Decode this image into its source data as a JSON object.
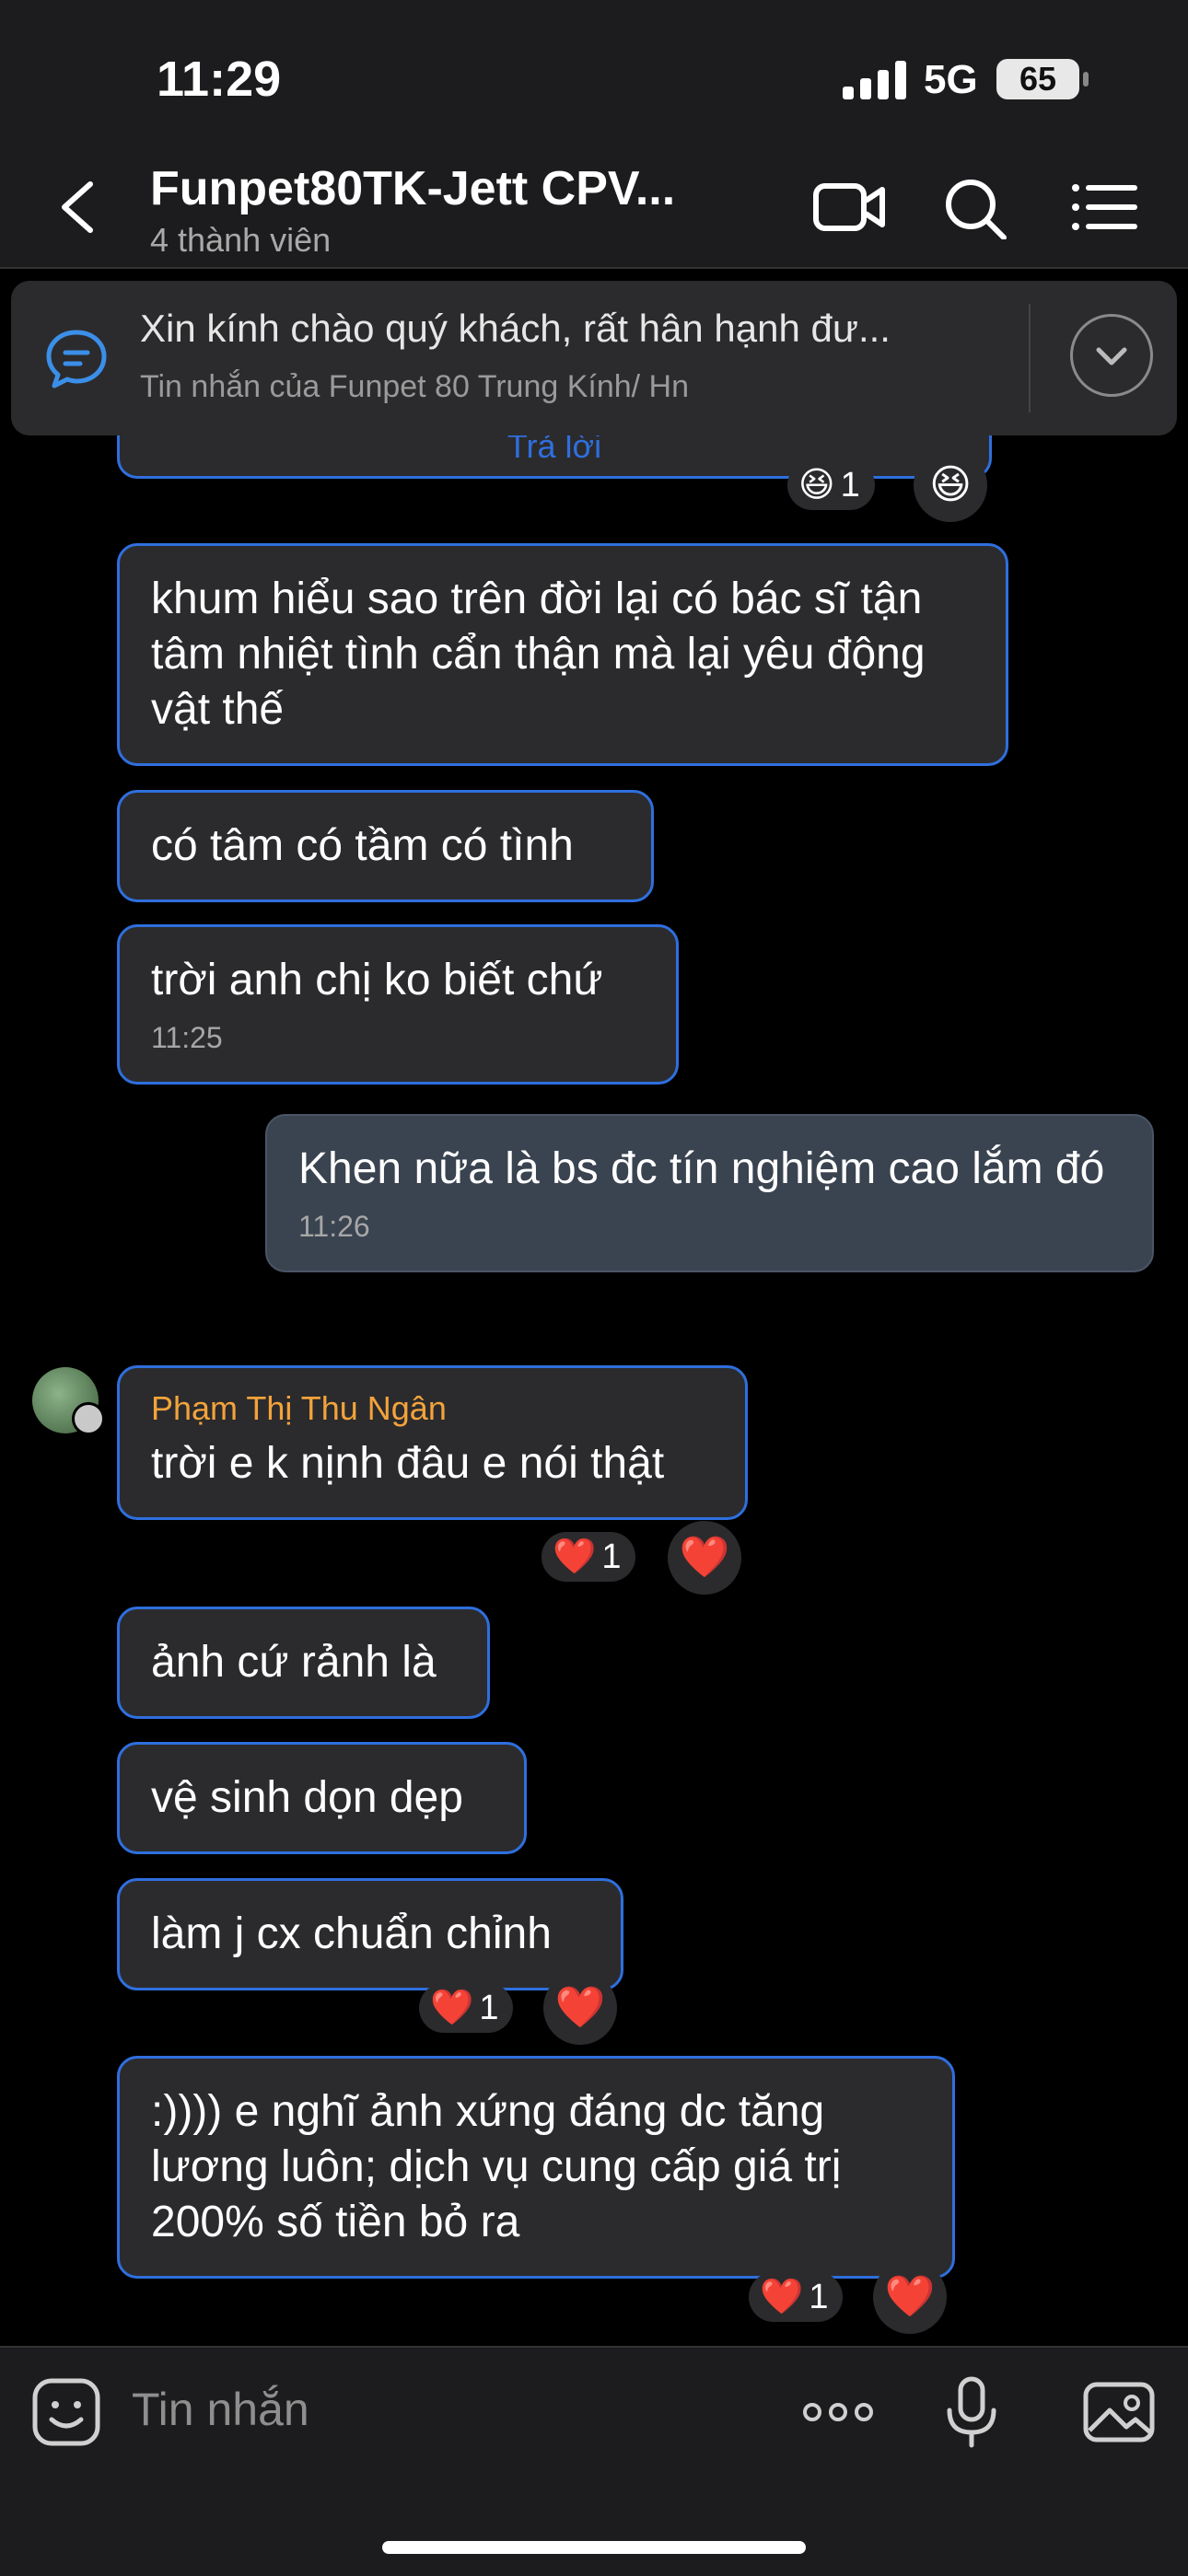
{
  "status": {
    "time": "11:29",
    "network": "5G",
    "battery": "65"
  },
  "header": {
    "title": "Funpet80TK-Jett CPV...",
    "subtitle": "4 thành viên"
  },
  "pinned": {
    "text": "Xin kính chào quý khách, rất hân hạnh đư...",
    "source": "Tin nhắn của Funpet 80 Trung Kính/ Hn"
  },
  "top_partial": {
    "link": "Trả lời",
    "reaction_count": "1"
  },
  "messages": [
    {
      "text": "khum hiểu sao trên đời lại có bác sĩ tận tâm nhiệt tình cẩn thận mà lại yêu động vật thế"
    },
    {
      "text": "có tâm có tầm có tình"
    },
    {
      "text": "trời anh chị ko biết chứ",
      "time": "11:25"
    },
    {
      "text": "Khen nữa là bs đc tín nghiệm cao lắm đó",
      "time": "11:26"
    },
    {
      "sender": "Phạm Thị Thu Ngân",
      "text": "trời e k nịnh đâu e nói thật",
      "reaction_count": "1"
    },
    {
      "text": "ảnh cứ rảnh là"
    },
    {
      "text": "vệ sinh dọn dẹp"
    },
    {
      "text": "làm j cx chuẩn chỉnh",
      "reaction_count": "1"
    },
    {
      "text": ":)))) e nghĩ ảnh xứng đáng dc tăng lương luôn; dịch vụ cung cấp giá trị 200% số tiền bỏ ra",
      "reaction_count": "1"
    }
  ],
  "composer": {
    "placeholder": "Tin nhắn"
  },
  "colors": {
    "accent": "#2f6fde",
    "sender_name": "#f3a33b",
    "bubble": "#2b2b2d",
    "my_bubble": "#3a4350"
  }
}
